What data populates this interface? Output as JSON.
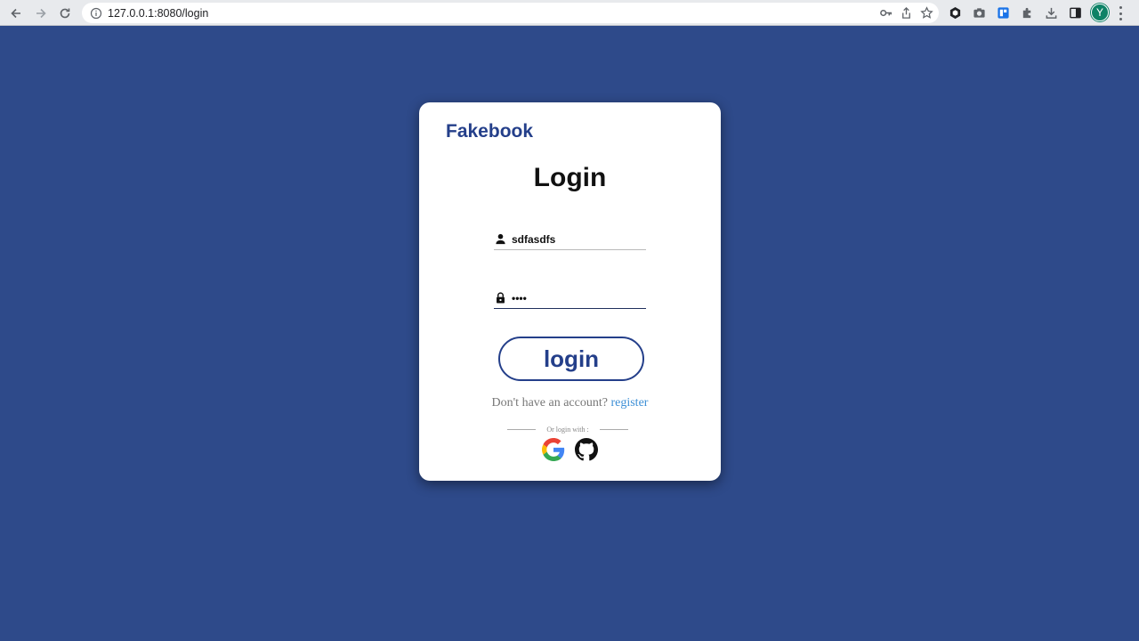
{
  "browser": {
    "url": "127.0.0.1:8080/login",
    "profile_initial": "Y",
    "profile_color": "#0d8266"
  },
  "card": {
    "brand": "Fakebook",
    "title": "Login",
    "username": "sdfasdfs",
    "password": "••••",
    "login_label": "login",
    "no_account_text": "Don't have an account?",
    "register_link": "register",
    "or_login_text": "Or login with :",
    "social_icons": [
      "google-icon",
      "github-icon"
    ]
  },
  "colors": {
    "background": "#2e4a8a",
    "brand": "#243f8a",
    "link": "#3d8fd6"
  }
}
